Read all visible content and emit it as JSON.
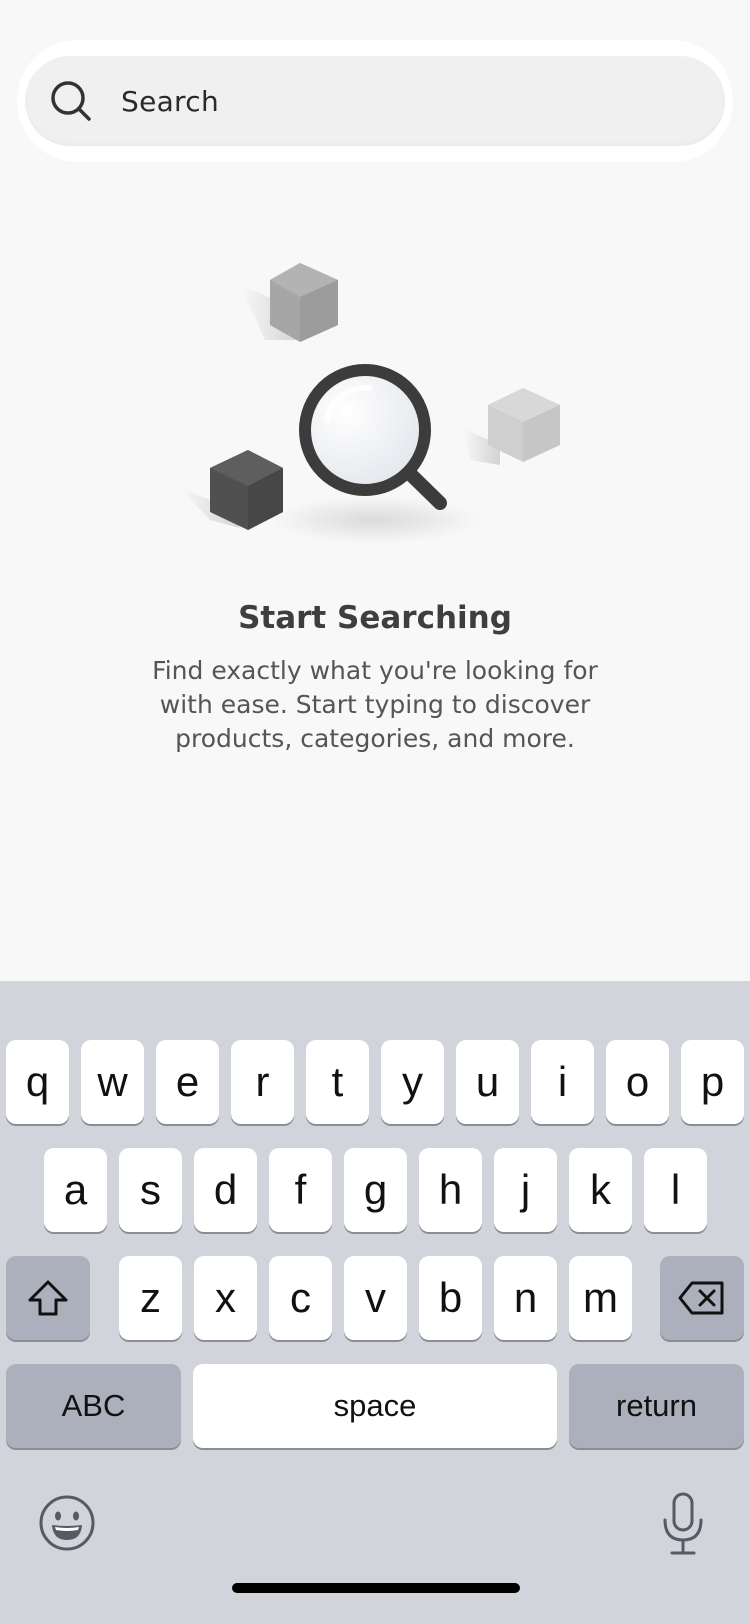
{
  "search": {
    "placeholder": "Search",
    "icon": "search-icon"
  },
  "empty_state": {
    "title": "Start Searching",
    "subtitle": "Find exactly what you're looking for with ease. Start typing to discover products, categories, and more."
  },
  "keyboard": {
    "row1": [
      "q",
      "w",
      "e",
      "r",
      "t",
      "y",
      "u",
      "i",
      "o",
      "p"
    ],
    "row2": [
      "a",
      "s",
      "d",
      "f",
      "g",
      "h",
      "j",
      "k",
      "l"
    ],
    "row3": [
      "z",
      "x",
      "c",
      "v",
      "b",
      "n",
      "m"
    ],
    "abc_label": "ABC",
    "space_label": "space",
    "return_label": "return",
    "shift_icon": "shift-icon",
    "delete_icon": "backspace-icon",
    "emoji_icon": "emoji-icon",
    "mic_icon": "microphone-icon"
  },
  "colors": {
    "background": "#f8f8f8",
    "keyboard_bg": "#d1d4db",
    "function_key": "#abb0bc",
    "text_dark": "#3e3e3e"
  }
}
